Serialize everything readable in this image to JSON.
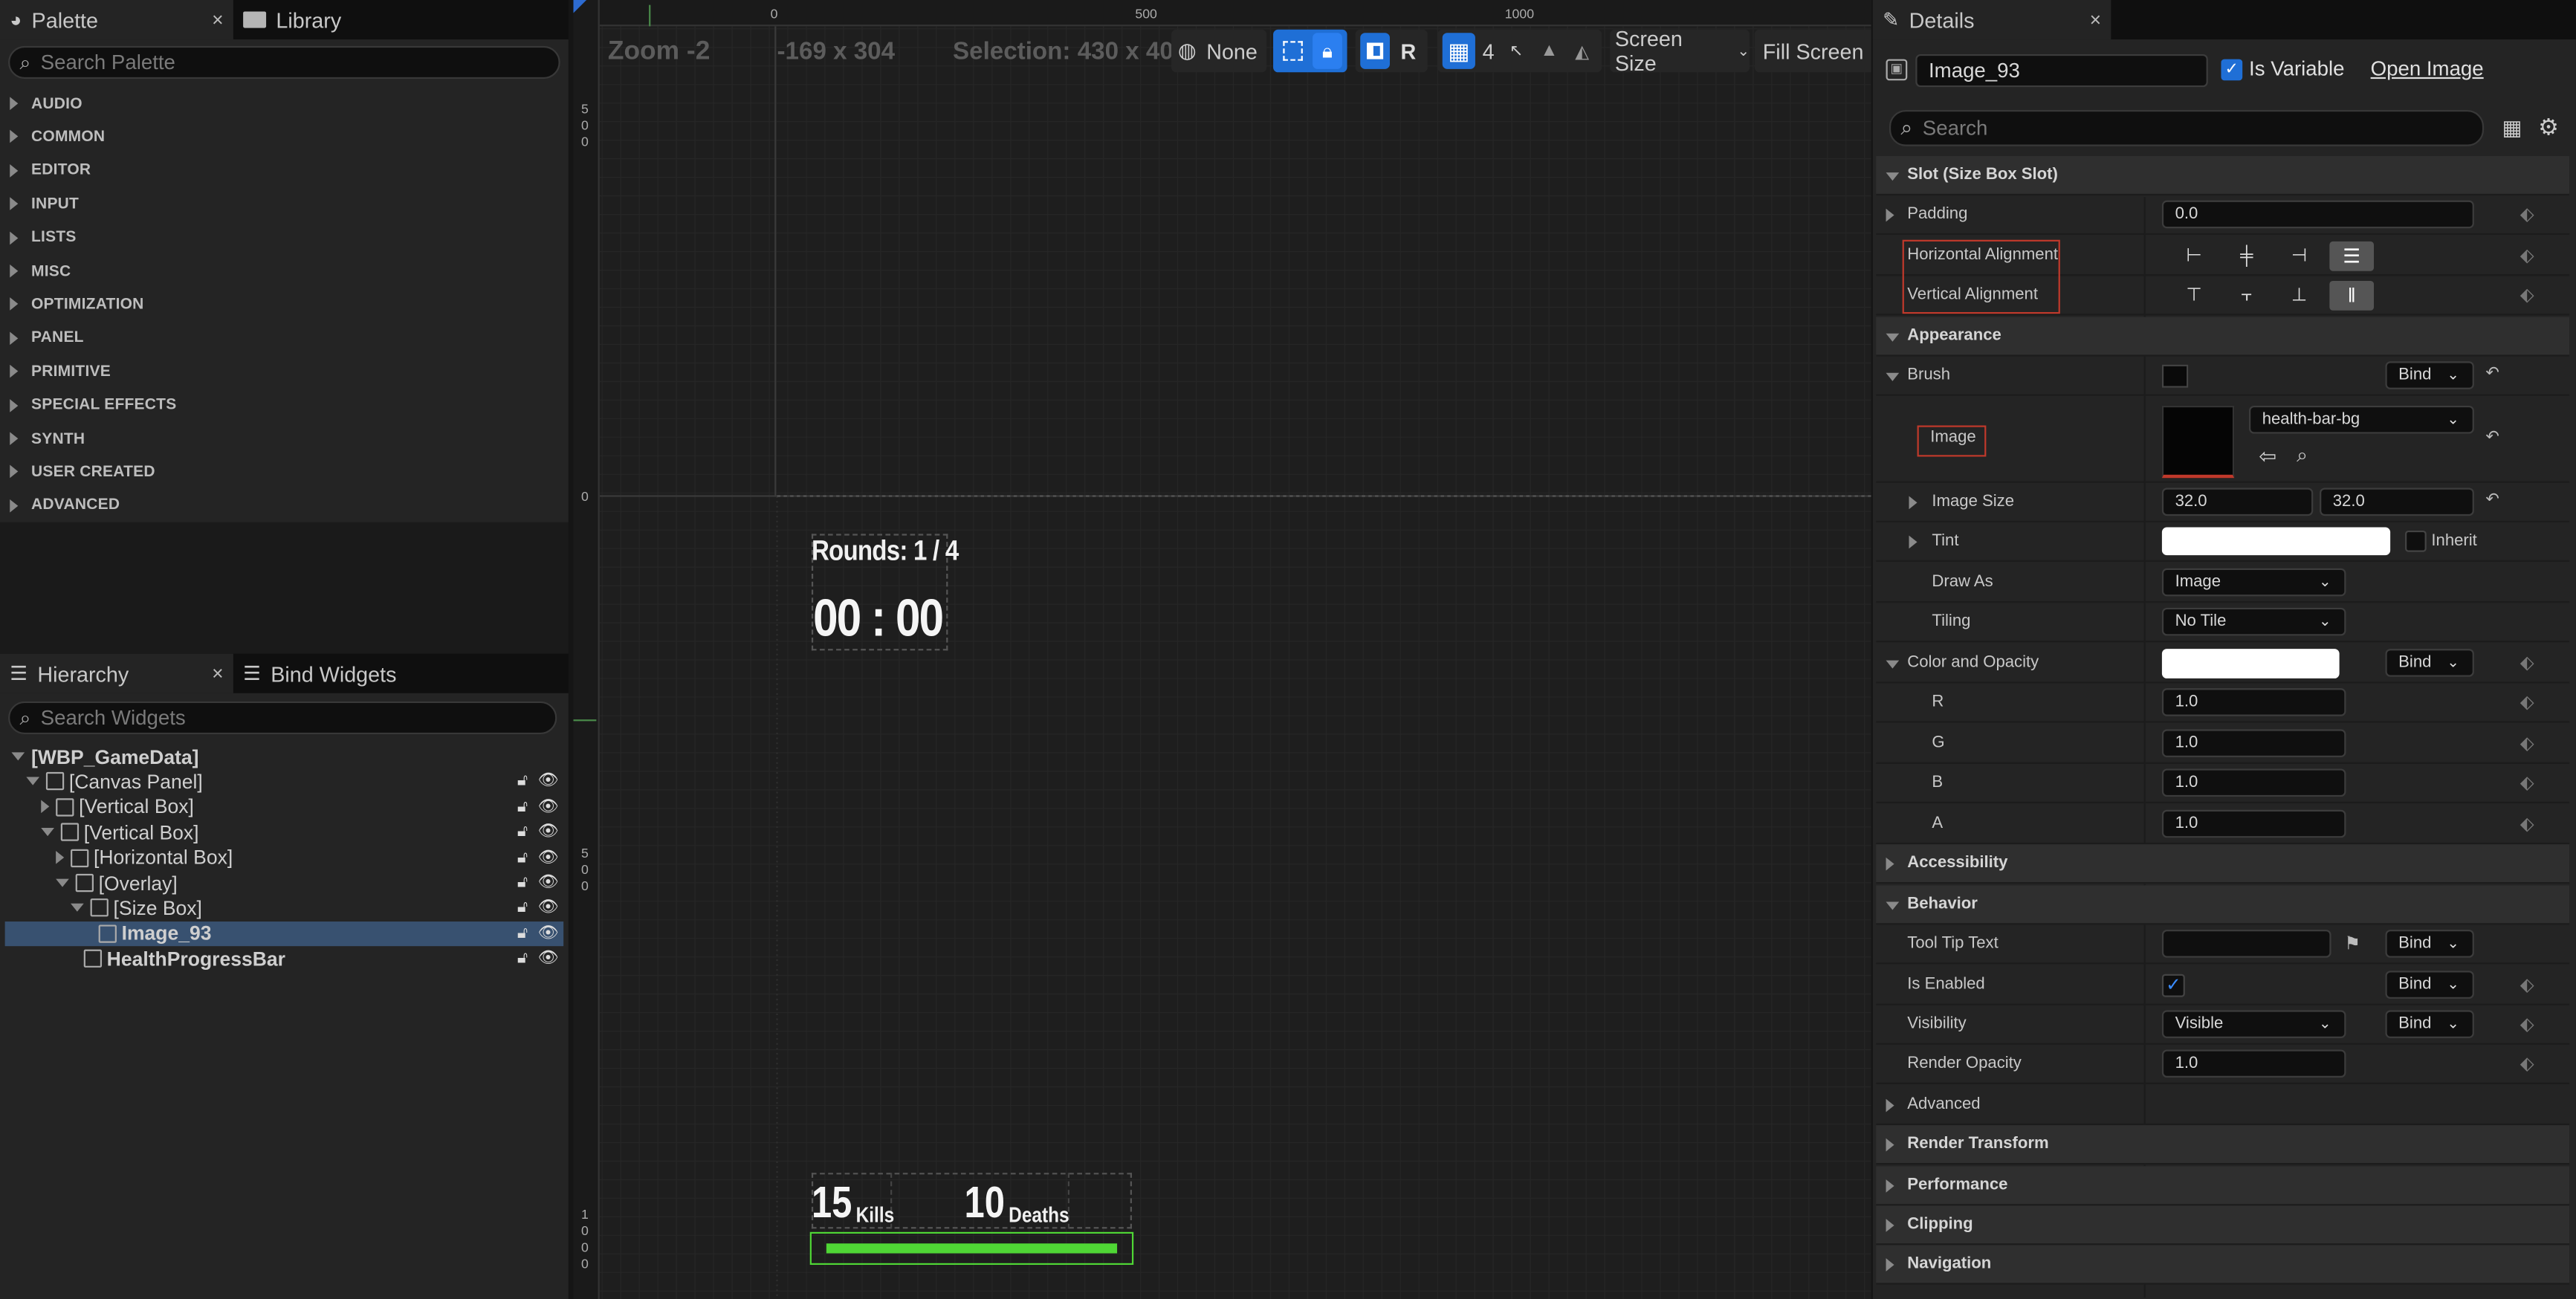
{
  "palette": {
    "tab_label": "Palette",
    "library_tab_label": "Library",
    "close_glyph": "×",
    "search_placeholder": "Search Palette",
    "categories": [
      "AUDIO",
      "COMMON",
      "EDITOR",
      "INPUT",
      "LISTS",
      "MISC",
      "OPTIMIZATION",
      "PANEL",
      "PRIMITIVE",
      "SPECIAL EFFECTS",
      "SYNTH",
      "USER CREATED",
      "ADVANCED"
    ]
  },
  "hierarchy": {
    "tab_label": "Hierarchy",
    "bind_tab_label": "Bind Widgets",
    "close_glyph": "×",
    "search_placeholder": "Search Widgets",
    "items": [
      {
        "label": "[WBP_GameData]",
        "depth": 0
      },
      {
        "label": "[Canvas Panel]",
        "depth": 1
      },
      {
        "label": "[Vertical Box]",
        "depth": 2
      },
      {
        "label": "[Vertical Box]",
        "depth": 2
      },
      {
        "label": "[Horizontal Box]",
        "depth": 3
      },
      {
        "label": "[Overlay]",
        "depth": 3
      },
      {
        "label": "[Size Box]",
        "depth": 4
      },
      {
        "label": "Image_93",
        "depth": 5,
        "selected": true
      },
      {
        "label": "HealthProgressBar",
        "depth": 4
      }
    ]
  },
  "viewport": {
    "zoom": "Zoom -2",
    "coords": "-169 x 304",
    "selection": "Selection: 430 x 40",
    "none_label": "None",
    "r_label": "R",
    "grid_value": "4",
    "screen_size": "Screen Size",
    "fill_screen": "Fill Screen",
    "ruler_x": [
      "0",
      "500",
      "1000"
    ],
    "ruler_y": [
      [
        "5",
        "0",
        "0"
      ],
      [
        "0"
      ],
      [
        "5",
        "0",
        "0"
      ],
      [
        "1",
        "0",
        "0",
        "0"
      ]
    ],
    "hud": {
      "rounds": "Rounds: 1 / 4",
      "timer": "00 : 00",
      "kills_value": "15",
      "kills_label": "Kills",
      "deaths_value": "10",
      "deaths_label": "Deaths",
      "health_fill": 1.0
    }
  },
  "details": {
    "tab_label": "Details",
    "close_glyph": "×",
    "widget_name": "Image_93",
    "is_variable_label": "Is Variable",
    "open_image_label": "Open Image",
    "search_placeholder": "Search",
    "sections": {
      "slot": "Slot (Size Box Slot)",
      "appearance": "Appearance",
      "behavior": "Behavior",
      "accessibility": "Accessibility",
      "render_transform": "Render Transform",
      "performance": "Performance",
      "clipping": "Clipping",
      "navigation": "Navigation"
    },
    "padding_label": "Padding",
    "padding_value": "0.0",
    "h_align_label": "Horizontal Alignment",
    "v_align_label": "Vertical Alignment",
    "brush_label": "Brush",
    "bind_label": "Bind",
    "image_label": "Image",
    "image_asset": "health-bar-bg",
    "image_size_label": "Image Size",
    "image_size_x": "32.0",
    "image_size_y": "32.0",
    "tint_label": "Tint",
    "inherit_label": "Inherit",
    "draw_as_label": "Draw As",
    "draw_as_value": "Image",
    "tiling_label": "Tiling",
    "tiling_value": "No Tile",
    "color_opacity_label": "Color and Opacity",
    "r_label": "R",
    "r_value": "1.0",
    "g_label": "G",
    "g_value": "1.0",
    "b_label": "B",
    "b_value": "1.0",
    "a_label": "A",
    "a_value": "1.0",
    "tooltip_label": "Tool Tip Text",
    "is_enabled_label": "Is Enabled",
    "visibility_label": "Visibility",
    "visibility_value": "Visible",
    "render_opacity_label": "Render Opacity",
    "render_opacity_value": "1.0",
    "advanced_label": "Advanced"
  },
  "colors": {
    "accent_blue": "#1f6fd6",
    "health_green": "#4fd635",
    "selection_row": "#385170",
    "highlight_red": "#c0392b"
  }
}
